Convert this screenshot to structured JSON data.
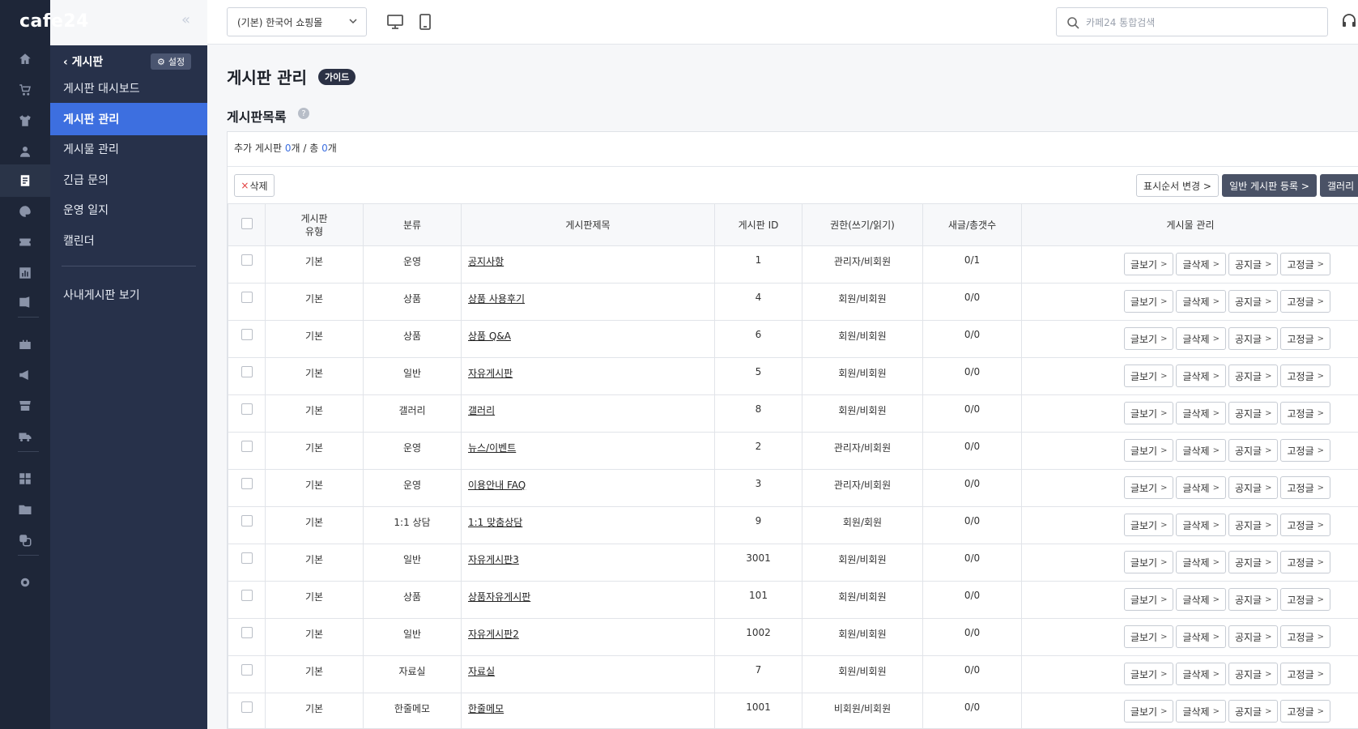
{
  "brand": {
    "logo": "cafe24",
    "collapse_icon": "«"
  },
  "rail_icons": [
    "home-icon",
    "cart-icon",
    "shirt-icon",
    "person-icon",
    "board-icon",
    "palette-icon",
    "ticket-icon",
    "chart-icon",
    "megaphone-icon",
    "briefcase-icon",
    "bullhorn-icon",
    "store-icon",
    "truck-icon",
    "apps-icon",
    "folder-icon",
    "copy-icon",
    "gear-icon"
  ],
  "subnav": {
    "back_label": "게시판",
    "settings_label": "설정",
    "items": [
      {
        "label": "게시판 대시보드"
      },
      {
        "label": "게시판 관리"
      },
      {
        "label": "게시물 관리"
      },
      {
        "label": "긴급 문의"
      },
      {
        "label": "운영 일지"
      },
      {
        "label": "캘린더"
      }
    ],
    "extra_item": "사내게시판 보기"
  },
  "topbar": {
    "mall_select": "(기본) 한국어 쇼핑몰",
    "search_placeholder": "카페24 통합검색"
  },
  "page": {
    "title": "게시판 관리",
    "guide_badge": "가이드",
    "section_title": "게시판목록",
    "help": "?",
    "summary_prefix": "추가 게시판 ",
    "added_count": "0",
    "summary_mid": "개 / 총 ",
    "total_count": "0",
    "summary_suffix": "개"
  },
  "toolbar": {
    "delete_label": "삭제",
    "reorder_label": "표시순서 변경 >",
    "register_general_label": "일반 게시판 등록 >",
    "register_gallery_label": "갤러리"
  },
  "table": {
    "headers": {
      "type": "게시판\n유형",
      "category": "분류",
      "title": "게시판제목",
      "board_id": "게시판 ID",
      "permission": "권한(쓰기/읽기)",
      "counts": "새글/총갯수",
      "manage": "게시물 관리"
    },
    "action_labels": [
      "글보기",
      "글삭제",
      "공지글",
      "고정글"
    ],
    "rows": [
      {
        "type": "기본",
        "category": "운영",
        "title": "공지사항",
        "id": "1",
        "perm": "관리자/비회원",
        "counts": "0/1"
      },
      {
        "type": "기본",
        "category": "상품",
        "title": "상품 사용후기",
        "id": "4",
        "perm": "회원/비회원",
        "counts": "0/0"
      },
      {
        "type": "기본",
        "category": "상품",
        "title": "상품 Q&A",
        "id": "6",
        "perm": "회원/비회원",
        "counts": "0/0"
      },
      {
        "type": "기본",
        "category": "일반",
        "title": "자유게시판",
        "id": "5",
        "perm": "회원/비회원",
        "counts": "0/0"
      },
      {
        "type": "기본",
        "category": "갤러리",
        "title": "갤러리",
        "id": "8",
        "perm": "회원/비회원",
        "counts": "0/0"
      },
      {
        "type": "기본",
        "category": "운영",
        "title": "뉴스/이벤트",
        "id": "2",
        "perm": "관리자/비회원",
        "counts": "0/0"
      },
      {
        "type": "기본",
        "category": "운영",
        "title": "이용안내 FAQ",
        "id": "3",
        "perm": "관리자/비회원",
        "counts": "0/0"
      },
      {
        "type": "기본",
        "category": "1:1 상담",
        "title": "1:1 맞춤상담",
        "id": "9",
        "perm": "회원/회원",
        "counts": "0/0"
      },
      {
        "type": "기본",
        "category": "일반",
        "title": "자유게시판3",
        "id": "3001",
        "perm": "회원/비회원",
        "counts": "0/0"
      },
      {
        "type": "기본",
        "category": "상품",
        "title": "상품자유게시판",
        "id": "101",
        "perm": "회원/비회원",
        "counts": "0/0"
      },
      {
        "type": "기본",
        "category": "일반",
        "title": "자유게시판2",
        "id": "1002",
        "perm": "회원/비회원",
        "counts": "0/0"
      },
      {
        "type": "기본",
        "category": "자료실",
        "title": "자료실",
        "id": "7",
        "perm": "회원/비회원",
        "counts": "0/0"
      },
      {
        "type": "기본",
        "category": "한줄메모",
        "title": "한줄메모",
        "id": "1001",
        "perm": "비회원/비회원",
        "counts": "0/0"
      }
    ]
  },
  "colors": {
    "accent": "#3d6fe0",
    "rail": "#1e2638",
    "subnav": "#27314a"
  }
}
